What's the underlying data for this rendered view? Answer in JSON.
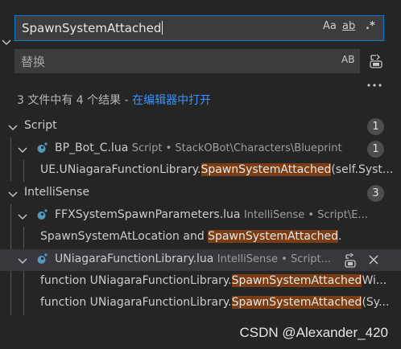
{
  "search": {
    "value": "SpawnSystemAttached",
    "match_case_label": "Aa",
    "whole_word_label": "ab",
    "regex_label": ".*"
  },
  "replace": {
    "placeholder": "替换",
    "preserve_case_label": "AB"
  },
  "summary": {
    "text": "3 文件中有 4 个结果 - ",
    "link": "在编辑器中打开"
  },
  "groups": [
    {
      "name": "Script",
      "count": "1",
      "files": [
        {
          "name": "BP_Bot_C.lua",
          "path": "Script • StackOBot\\Characters\\Blueprint",
          "count": "1",
          "matches": [
            {
              "pre": "UE.UNiagaraFunctionLibrary.",
              "hit": "SpawnSystemAttached",
              "post": "(self.Syst..."
            }
          ]
        }
      ]
    },
    {
      "name": "IntelliSense",
      "count": "3",
      "files": [
        {
          "name": "FFXSystemSpawnParameters.lua",
          "path": "IntelliSense • Script\\E...",
          "matches": [
            {
              "pre": "SpawnSystemAtLocation and ",
              "hit": "SpawnSystemAttached",
              "post": "."
            }
          ]
        },
        {
          "name": "UNiagaraFunctionLibrary.lua",
          "path": "IntelliSense • Script...",
          "matches": [
            {
              "pre": "function UNiagaraFunctionLibrary.",
              "hit": "SpawnSystemAttached",
              "post": "Wi..."
            },
            {
              "pre": "function UNiagaraFunctionLibrary.",
              "hit": "SpawnSystemAttached",
              "post": "(Sy..."
            }
          ]
        }
      ]
    }
  ],
  "watermark": "CSDN @Alexander_420",
  "colors": {
    "background": "#252526",
    "input_bg": "#3c3c3c",
    "focus_border": "#007fd4",
    "link": "#3794ff",
    "match_highlight": "#7a3d14",
    "lua_icon": "#519aba"
  },
  "icons": [
    "chevron-right-icon",
    "replace-all-icon",
    "more-icon",
    "chevron-down-icon",
    "lua-file-icon",
    "replace-icon",
    "close-icon"
  ]
}
